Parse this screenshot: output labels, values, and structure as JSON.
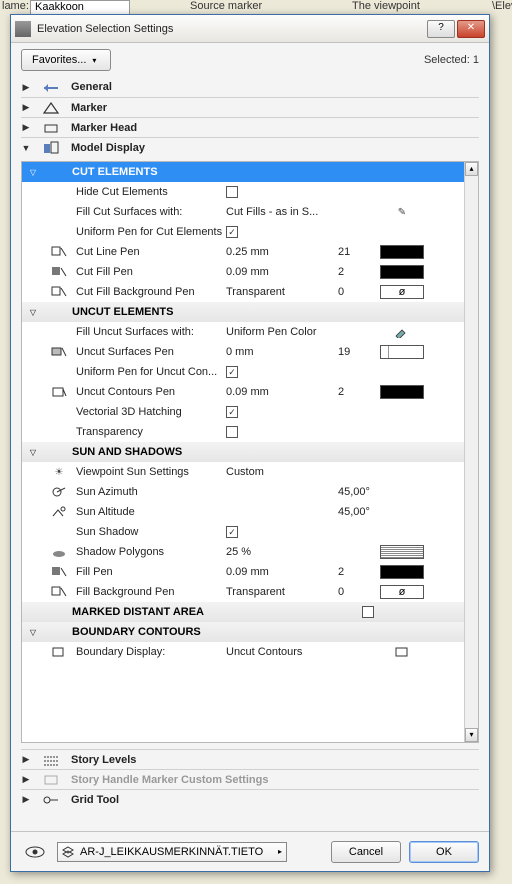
{
  "background": {
    "name_label": "lame:",
    "name_value": "Kaakkoon",
    "source_label": "Source marker",
    "viewpoint_label": "The viewpoint",
    "elev_label": "\\Elev"
  },
  "dialog": {
    "title": "Elevation Selection Settings",
    "favorites": "Favorites...",
    "selected": "Selected: 1",
    "sections": {
      "general": "General",
      "marker": "Marker",
      "marker_head": "Marker Head",
      "model_display": "Model Display",
      "story_levels": "Story Levels",
      "story_handle": "Story Handle Marker Custom Settings",
      "grid_tool": "Grid Tool"
    },
    "groups": {
      "cut": "CUT ELEMENTS",
      "uncut": "UNCUT ELEMENTS",
      "sun": "SUN AND SHADOWS",
      "marked": "MARKED DISTANT AREA",
      "boundary": "BOUNDARY CONTOURS"
    },
    "rows": {
      "hide_cut": "Hide Cut Elements",
      "fill_cut_surf": "Fill Cut Surfaces with:",
      "fill_cut_surf_v": "Cut Fills - as in S...",
      "uni_pen_cut": "Uniform Pen for Cut Elements",
      "cut_line_pen": "Cut Line Pen",
      "cut_line_pen_v": "0.25 mm",
      "cut_line_pen_n": "21",
      "cut_fill_pen": "Cut Fill Pen",
      "cut_fill_pen_v": "0.09 mm",
      "cut_fill_pen_n": "2",
      "cut_fill_bg": "Cut Fill Background Pen",
      "cut_fill_bg_v": "Transparent",
      "cut_fill_bg_n": "0",
      "fill_uncut": "Fill Uncut Surfaces with:",
      "fill_uncut_v": "Uniform Pen Color",
      "uncut_surf_pen": "Uncut Surfaces Pen",
      "uncut_surf_pen_v": "0 mm",
      "uncut_surf_pen_n": "19",
      "uni_pen_uncut": "Uniform Pen for Uncut Con...",
      "uncut_cont_pen": "Uncut Contours Pen",
      "uncut_cont_pen_v": "0.09 mm",
      "uncut_cont_pen_n": "2",
      "vect_hatch": "Vectorial 3D Hatching",
      "transparency": "Transparency",
      "vp_sun": "Viewpoint Sun Settings",
      "vp_sun_v": "Custom",
      "sun_az": "Sun Azimuth",
      "sun_az_v": "45,00°",
      "sun_alt": "Sun Altitude",
      "sun_alt_v": "45,00°",
      "sun_shadow": "Sun Shadow",
      "shadow_poly": "Shadow Polygons",
      "shadow_poly_v": "25 %",
      "fill_pen": "Fill Pen",
      "fill_pen_v": "0.09 mm",
      "fill_pen_n": "2",
      "fill_bg_pen": "Fill Background Pen",
      "fill_bg_pen_v": "Transparent",
      "fill_bg_pen_n": "0",
      "boundary_disp": "Boundary Display:",
      "boundary_disp_v": "Uncut Contours"
    },
    "layer": "AR-J_LEIKKAUSMERKINNÄT.TIETO",
    "cancel": "Cancel",
    "ok": "OK"
  }
}
